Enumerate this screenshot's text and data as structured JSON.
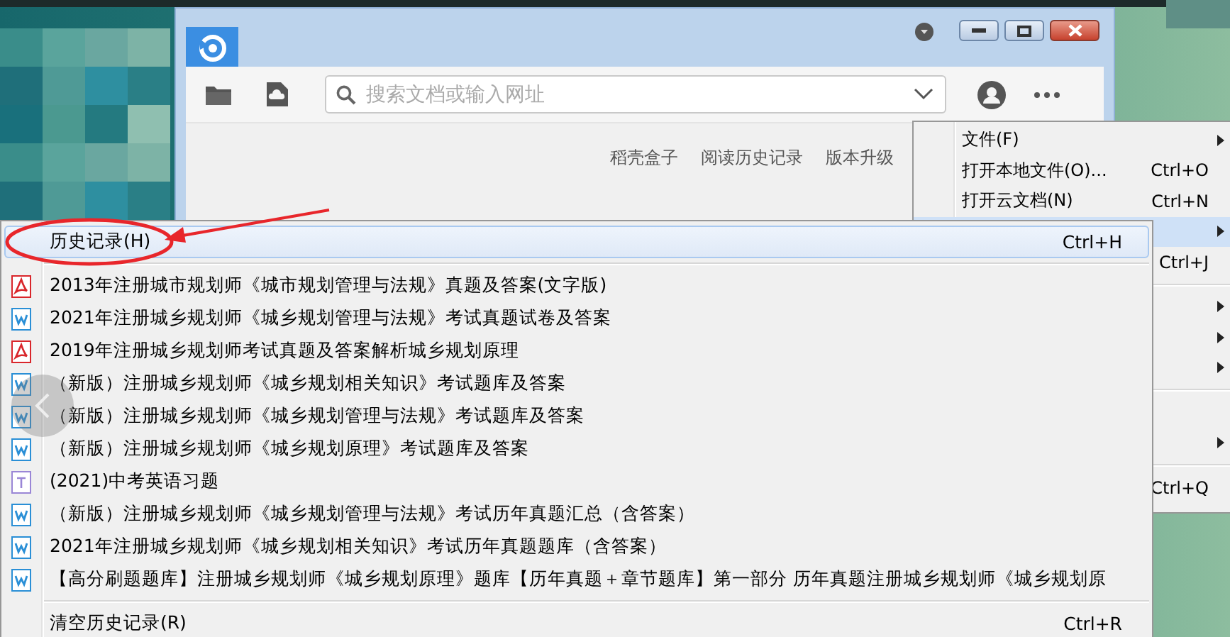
{
  "window": {
    "search": {
      "placeholder": "搜索文档或输入网址"
    },
    "links": [
      "稻壳盒子",
      "阅读历史记录",
      "版本升级"
    ]
  },
  "main_menu": {
    "items": [
      {
        "kind": "item",
        "label": "文件(F)",
        "submenu": true,
        "selected": false
      },
      {
        "kind": "item",
        "label": "打开本地文件(O)...",
        "shortcut": "Ctrl+O",
        "submenu": false,
        "selected": false
      },
      {
        "kind": "item",
        "label": "打开云文档(N)",
        "shortcut": "Ctrl+N",
        "submenu": false,
        "selected": false
      },
      {
        "kind": "item",
        "submenu": true,
        "selected": true
      },
      {
        "kind": "item",
        "shortcut": "Ctrl+J",
        "submenu": false,
        "selected": false
      },
      {
        "kind": "separator"
      },
      {
        "kind": "item",
        "submenu": true,
        "selected": false
      },
      {
        "kind": "item",
        "submenu": true,
        "selected": false
      },
      {
        "kind": "item",
        "submenu": true,
        "selected": false
      },
      {
        "kind": "separator"
      },
      {
        "kind": "item",
        "submenu": false,
        "selected": false
      },
      {
        "kind": "item",
        "submenu": true,
        "selected": false
      },
      {
        "kind": "separator"
      },
      {
        "kind": "item",
        "shortcut": "Ctrl+Q",
        "submenu": false,
        "selected": false
      }
    ]
  },
  "history_menu": {
    "header": {
      "label": "历史记录(H)",
      "shortcut": "Ctrl+H",
      "selected": true
    },
    "entries": [
      {
        "kind": "pdf",
        "label": "2013年注册城市规划师《城市规划管理与法规》真题及答案(文字版)",
        "selected": false
      },
      {
        "kind": "word",
        "label": "2021年注册城乡规划师《城乡规划管理与法规》考试真题试卷及答案",
        "selected": false
      },
      {
        "kind": "pdf",
        "label": "2019年注册城乡规划师考试真题及答案解析城乡规划原理",
        "selected": false
      },
      {
        "kind": "word",
        "label": "（新版）注册城乡规划师《城乡规划相关知识》考试题库及答案",
        "selected": false
      },
      {
        "kind": "word",
        "label": "（新版）注册城乡规划师《城乡规划管理与法规》考试题库及答案",
        "selected": false
      },
      {
        "kind": "word",
        "label": "（新版）注册城乡规划师《城乡规划原理》考试题库及答案",
        "selected": false
      },
      {
        "kind": "text",
        "label": "(2021)中考英语习题",
        "selected": false
      },
      {
        "kind": "word",
        "label": "（新版）注册城乡规划师《城乡规划管理与法规》考试历年真题汇总（含答案）",
        "selected": false
      },
      {
        "kind": "word",
        "label": "2021年注册城乡规划师《城乡规划相关知识》考试历年真题题库（含答案）",
        "selected": false
      },
      {
        "kind": "word",
        "label": "【高分刷题题库】注册城乡规划师《城乡规划原理》题库【历年真题＋章节题库】第一部分 历年真题注册城乡规划师《城乡规划原",
        "selected": false
      }
    ],
    "footer": {
      "label": "清空历史记录(R)",
      "shortcut": "Ctrl+R",
      "selected": false
    }
  }
}
